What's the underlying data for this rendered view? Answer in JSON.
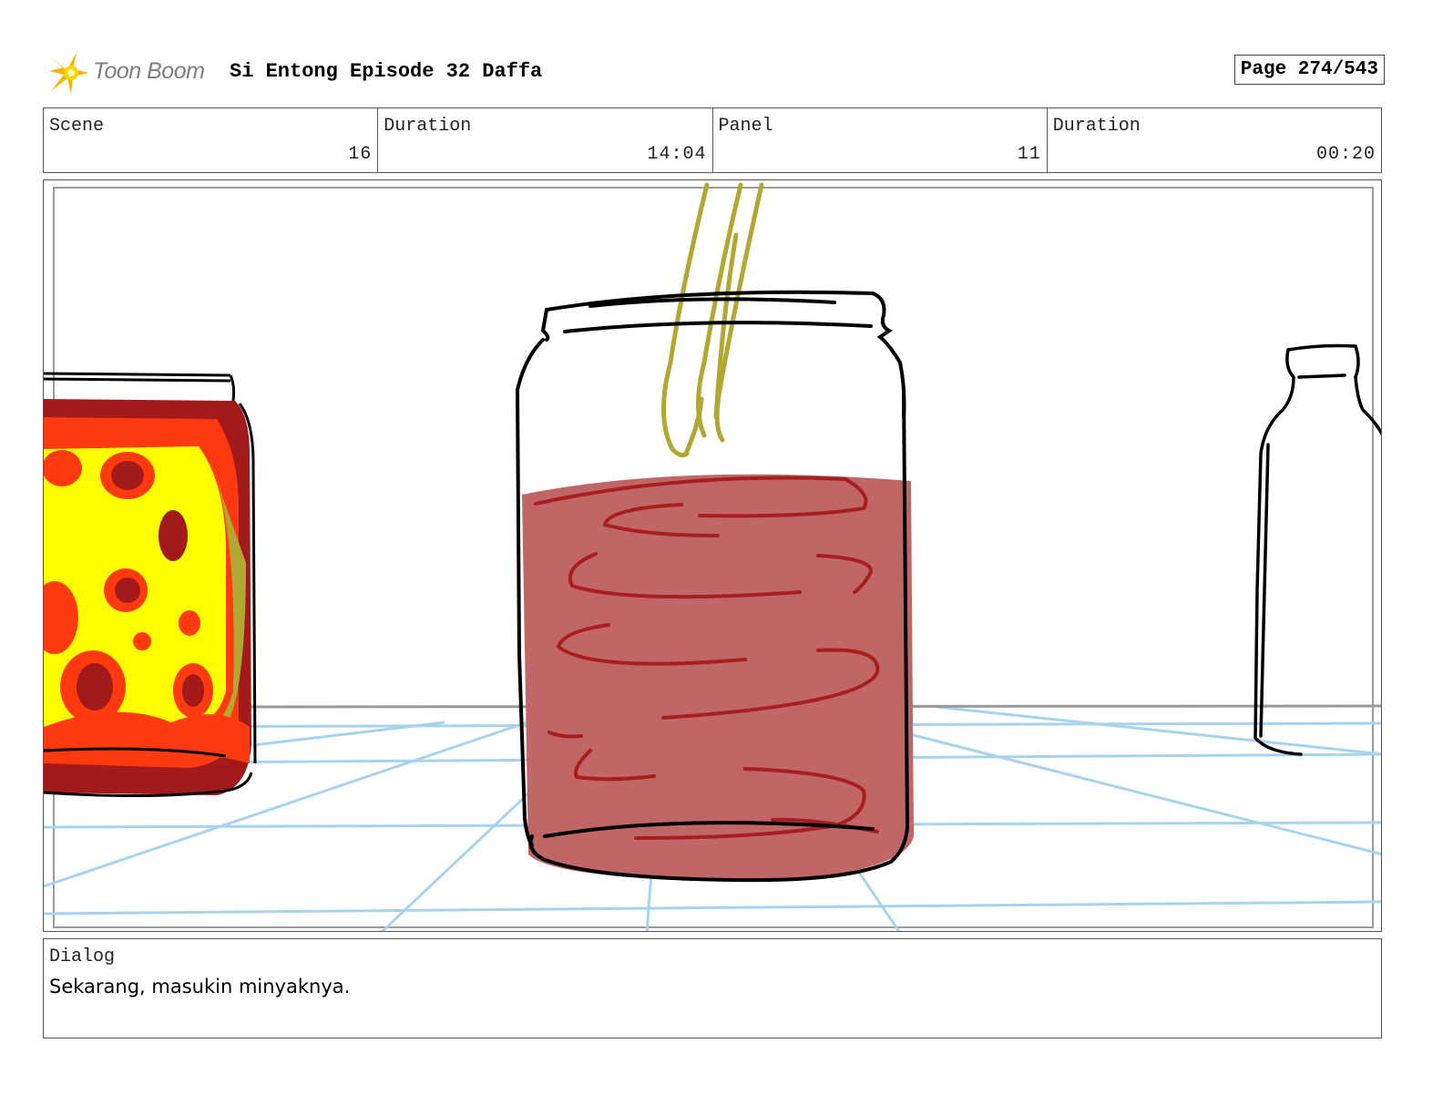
{
  "header": {
    "logo_text": "Toon Boom",
    "project_title": "Si Entong Episode 32 Daffa",
    "page_label": "Page 274/543"
  },
  "info": {
    "scene_label": "Scene",
    "scene_value": "16",
    "scene_duration_label": "Duration",
    "scene_duration_value": "14:04",
    "panel_label": "Panel",
    "panel_value": "11",
    "panel_duration_label": "Duration",
    "panel_duration_value": "00:20"
  },
  "dialog": {
    "label": "Dialog",
    "text": "Sekarang, masukin minyaknya."
  },
  "colors": {
    "jar_liquid": "#c06666",
    "swirl": "#a81e1e",
    "oil_stream": "#b0a830",
    "grid": "#a6d4ee",
    "pickle_yellow": "#ffff00",
    "pickle_orange": "#ff3a10",
    "pickle_darkred": "#a31a1a"
  }
}
